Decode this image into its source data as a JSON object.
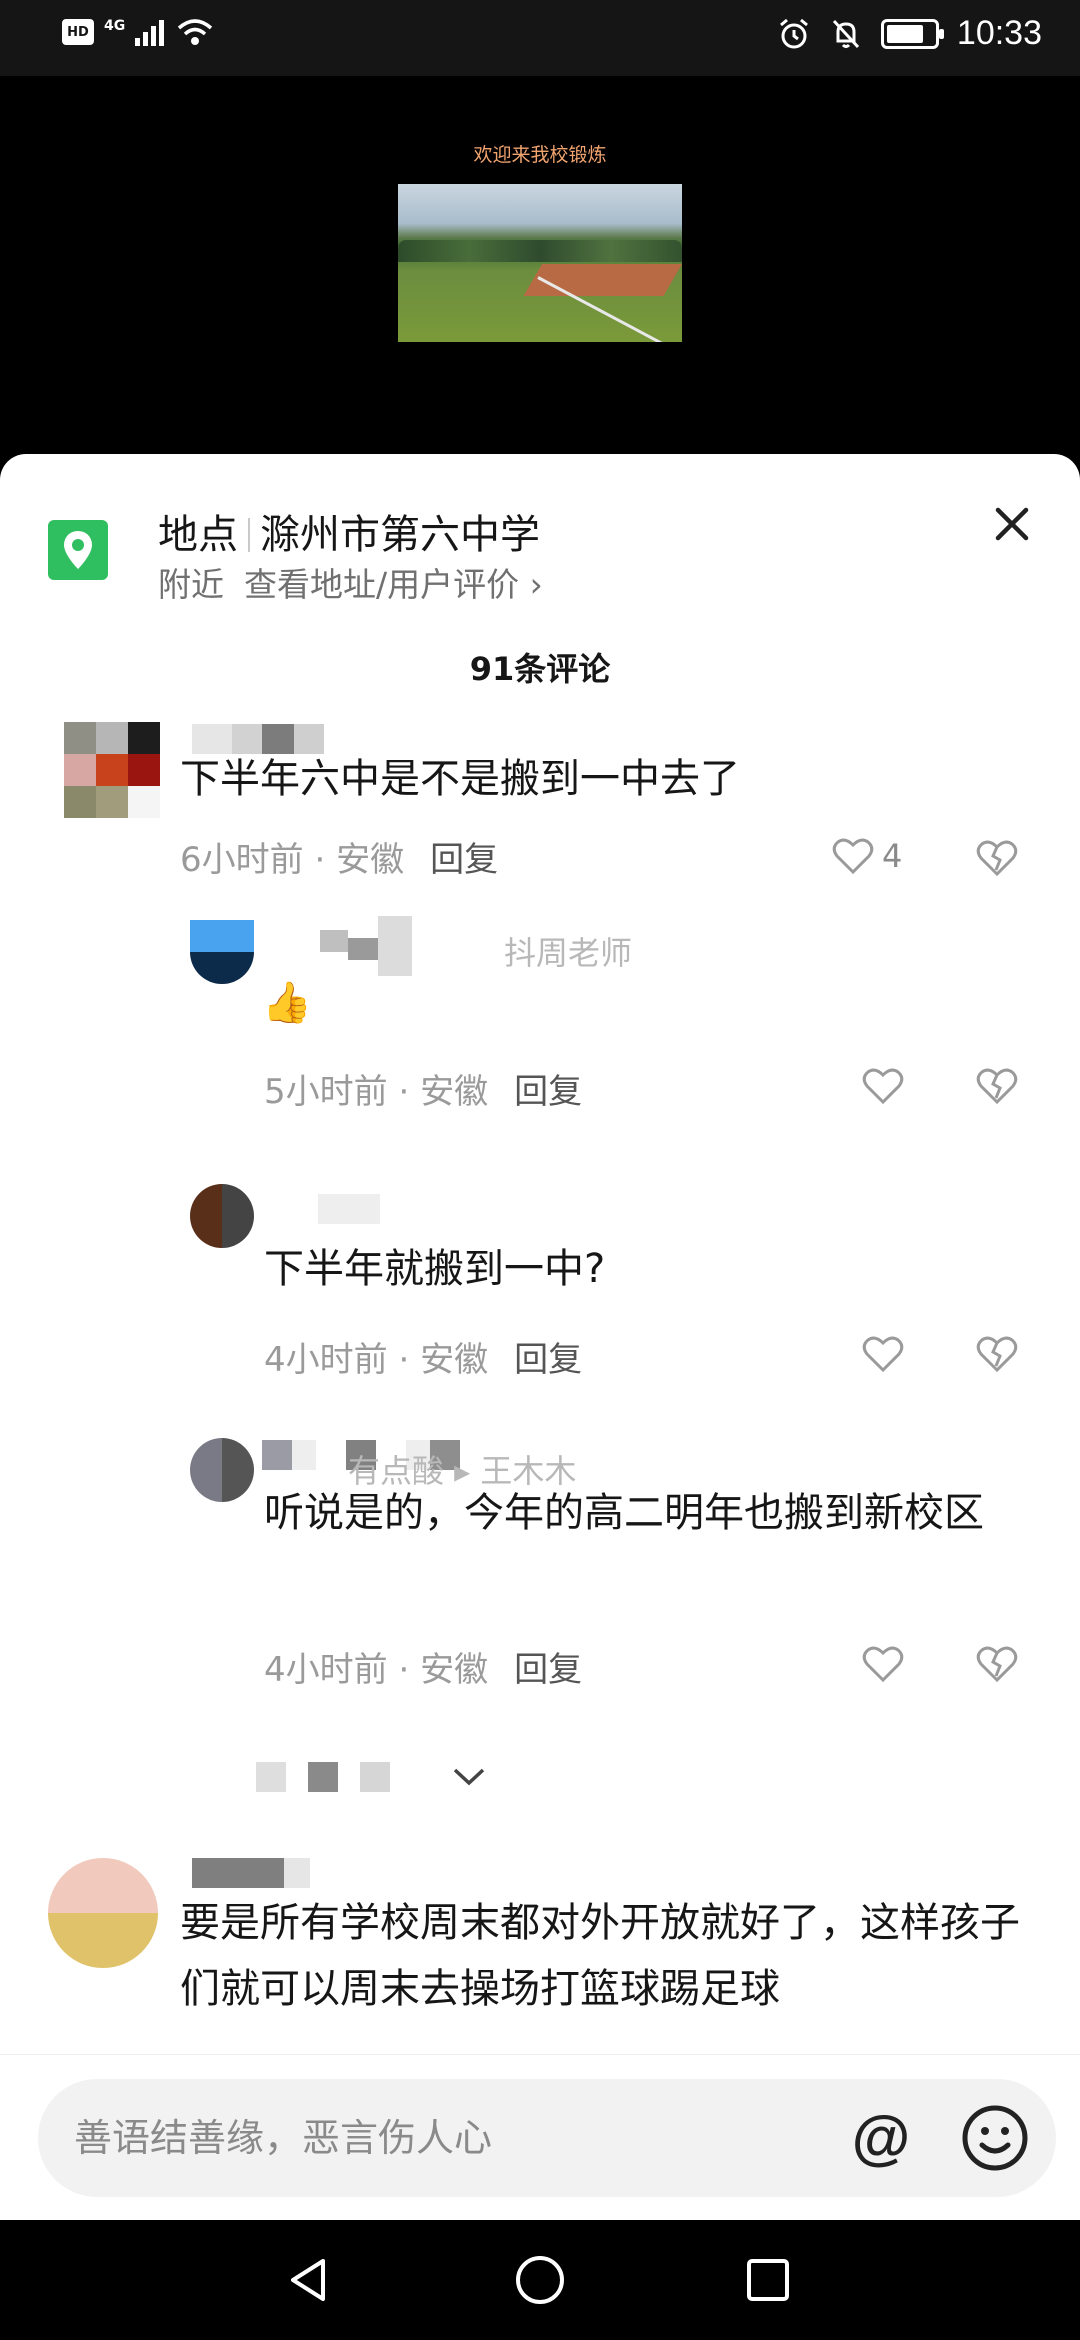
{
  "status_bar": {
    "hd": "HD",
    "network": "4G",
    "time": "10:33"
  },
  "video": {
    "caption": "欢迎来我校锻炼"
  },
  "location": {
    "label": "地点",
    "name": "滁州市第六中学",
    "nearby": "附近",
    "link": "查看地址/用户评价 ›"
  },
  "comments_header": {
    "count_text": "91条评论"
  },
  "comments": [
    {
      "text": "下半年六中是不是搬到一中去了",
      "time": "6小时前",
      "region": "安徽",
      "reply": "回复",
      "likes": "4"
    },
    {
      "text": "👍",
      "time": "5小时前",
      "region": "安徽",
      "reply": "回复",
      "reply_to": "抖周老师"
    },
    {
      "text": "下半年就搬到一中?",
      "time": "4小时前",
      "region": "安徽",
      "reply": "回复"
    },
    {
      "text": "听说是的，今年的高二明年也搬到新校区",
      "time": "4小时前",
      "region": "安徽",
      "reply": "回复",
      "reply_to": "有点酸 ▸ 王木木"
    },
    {
      "text": "要是所有学校周末都对外开放就好了，这样孩子们就可以周末去操场打篮球踢足球"
    }
  ],
  "input": {
    "placeholder": "善语结善缘，恶言伤人心",
    "at": "@"
  },
  "icons": {
    "location": "map-pin-icon",
    "close": "close-icon",
    "like": "heart-icon",
    "dislike": "broken-heart-icon",
    "expand": "chevron-down-icon",
    "emoji": "smiley-icon",
    "back": "back-triangle-icon",
    "home": "home-circle-icon",
    "recent": "recent-square-icon"
  },
  "colors": {
    "accent_green": "#2fbf60",
    "caption": "#f1a46f",
    "meta_gray": "#9a9a9a"
  }
}
